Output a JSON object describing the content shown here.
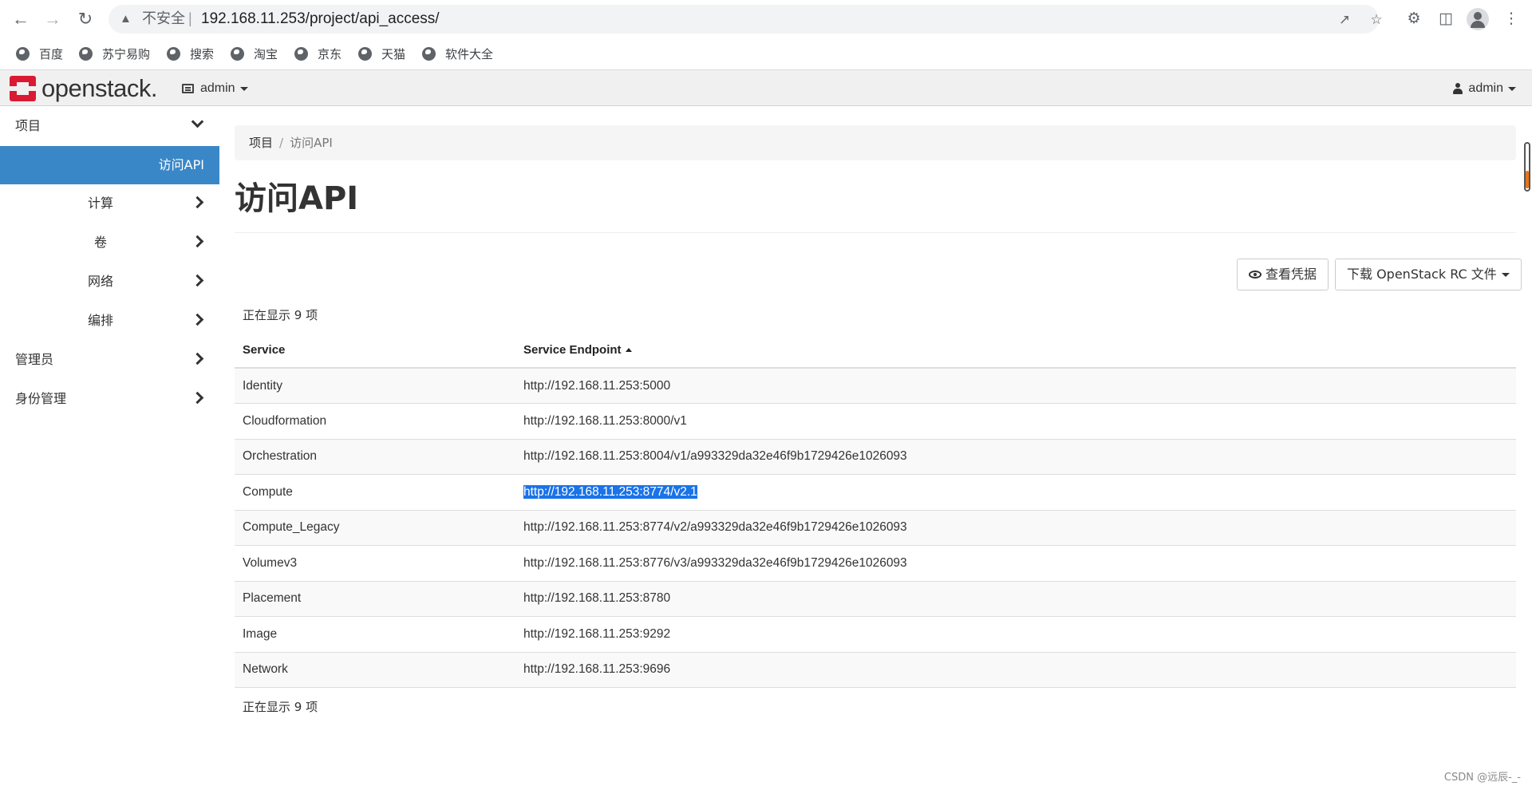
{
  "browser": {
    "insecure_label": "不安全",
    "url": "192.168.11.253/project/api_access/",
    "bookmarks": [
      "百度",
      "苏宁易购",
      "搜索",
      "淘宝",
      "京东",
      "天猫",
      "软件大全"
    ]
  },
  "header": {
    "logo": "openstack.",
    "project": "admin",
    "user": "admin"
  },
  "sidebar": {
    "items": [
      {
        "label": "项目",
        "state": "expanded"
      },
      {
        "label": "访问API",
        "state": "active"
      },
      {
        "label": "计算"
      },
      {
        "label": "卷"
      },
      {
        "label": "网络"
      },
      {
        "label": "编排"
      },
      {
        "label": "管理员"
      },
      {
        "label": "身份管理"
      }
    ]
  },
  "breadcrumb": {
    "items": [
      "项目",
      "访问API"
    ],
    "separator": "/"
  },
  "page": {
    "title": "访问API",
    "view_credentials": "查看凭据",
    "download_rc": "下载 OpenStack RC 文件",
    "count_top": "正在显示 9 项",
    "count_bottom": "正在显示 9 项"
  },
  "table": {
    "headers": [
      "Service",
      "Service Endpoint"
    ],
    "rows": [
      {
        "service": "Identity",
        "endpoint": "http://192.168.11.253:5000"
      },
      {
        "service": "Cloudformation",
        "endpoint": "http://192.168.11.253:8000/v1"
      },
      {
        "service": "Orchestration",
        "endpoint": "http://192.168.11.253:8004/v1/a993329da32e46f9b1729426e1026093"
      },
      {
        "service": "Compute",
        "endpoint": "http://192.168.11.253:8774/v2.1"
      },
      {
        "service": "Compute_Legacy",
        "endpoint": "http://192.168.11.253:8774/v2/a993329da32e46f9b1729426e1026093"
      },
      {
        "service": "Volumev3",
        "endpoint": "http://192.168.11.253:8776/v3/a993329da32e46f9b1729426e1026093"
      },
      {
        "service": "Placement",
        "endpoint": "http://192.168.11.253:8780"
      },
      {
        "service": "Image",
        "endpoint": "http://192.168.11.253:9292"
      },
      {
        "service": "Network",
        "endpoint": "http://192.168.11.253:9696"
      }
    ]
  },
  "watermark": "CSDN @远辰-_-",
  "colors": {
    "accent": "#3a87c8",
    "brand": "#da1a32",
    "selection": "#1a73e8"
  }
}
